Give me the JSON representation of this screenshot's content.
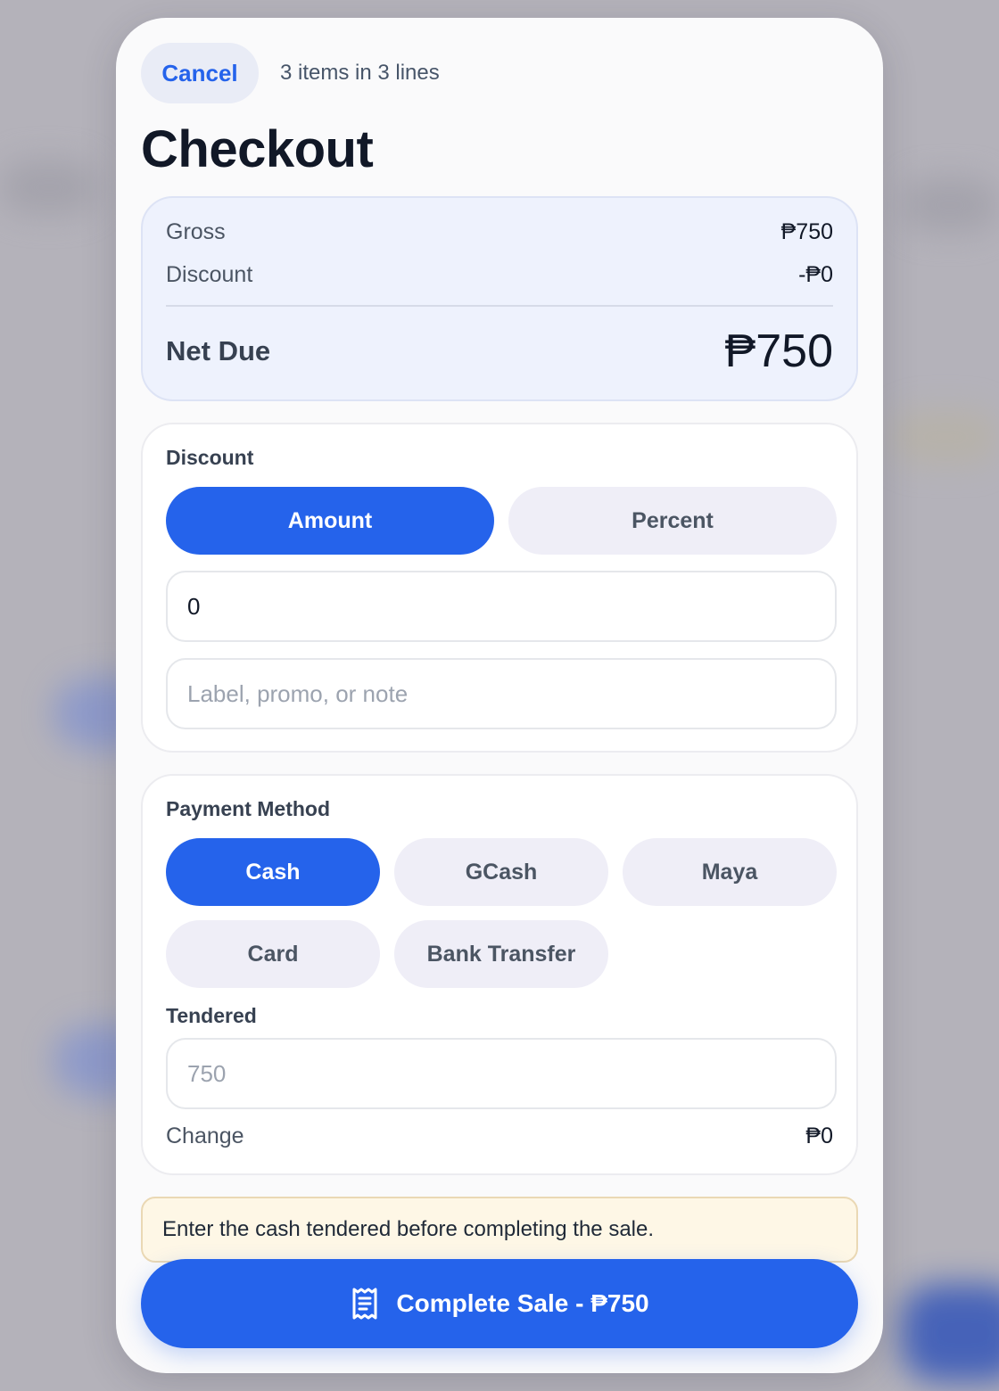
{
  "header": {
    "cancel_label": "Cancel",
    "items_summary": "3 items in 3 lines",
    "title": "Checkout"
  },
  "summary": {
    "gross_label": "Gross",
    "gross_value": "₱750",
    "discount_label": "Discount",
    "discount_value": "-₱0",
    "net_label": "Net Due",
    "net_value": "₱750"
  },
  "discount": {
    "section_label": "Discount",
    "modes": [
      "Amount",
      "Percent"
    ],
    "selected_mode": "Amount",
    "amount_value": "0",
    "note_placeholder": "Label, promo, or note"
  },
  "payment": {
    "section_label": "Payment Method",
    "methods": [
      "Cash",
      "GCash",
      "Maya",
      "Card",
      "Bank Transfer"
    ],
    "selected_method": "Cash",
    "tendered_label": "Tendered",
    "tendered_placeholder": "750",
    "change_label": "Change",
    "change_value": "₱0"
  },
  "notice": {
    "text": "Enter the cash tendered before completing the sale."
  },
  "footer": {
    "complete_label": "Complete Sale - ₱750",
    "complete_icon": "receipt-icon"
  },
  "colors": {
    "accent": "#2563eb",
    "summary_bg": "#eef2fd",
    "notice_bg": "#fef7e6",
    "pill_inactive": "#efeef7"
  }
}
